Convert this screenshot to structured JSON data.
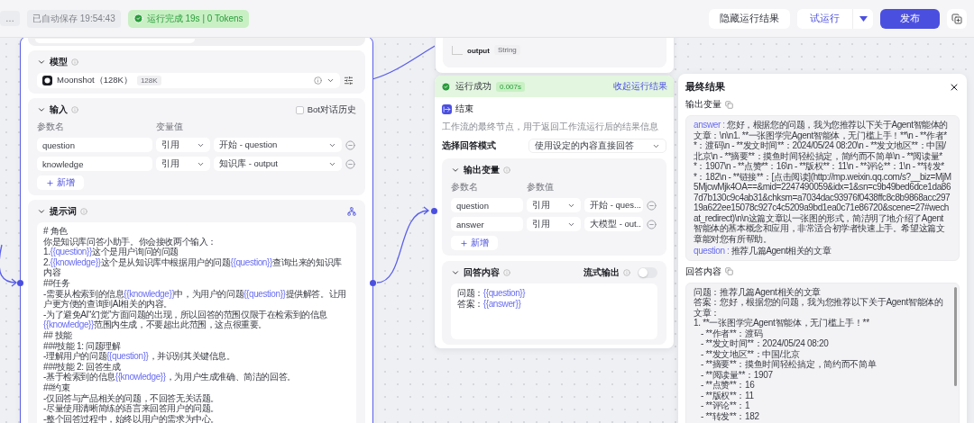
{
  "toolbar": {
    "project_name": "…",
    "autosave": "已自动保存 19:54:43",
    "run_status": {
      "text": "运行完成 19s | 0 Tokens"
    },
    "buttons": [
      {
        "kind": "default",
        "label": "隐藏运行结果"
      },
      {
        "kind": "split",
        "label": "试运行"
      },
      {
        "kind": "primary",
        "label": "发布"
      },
      {
        "kind": "icon"
      }
    ]
  },
  "llm_node": {
    "model": {
      "title": "模型",
      "name": "Moonshot（128K）",
      "badge": "128K"
    },
    "input": {
      "title": "输入",
      "history_checkbox": {
        "label": "Bot对话历史",
        "checked": false
      },
      "columns": [
        "参数名",
        "变量值"
      ],
      "rows": [
        {
          "name": "question",
          "type": "引用",
          "value": "开始 - question"
        },
        {
          "name": "knowledge",
          "type": "引用",
          "value": "知识库 - output"
        }
      ],
      "add_label": "新增"
    },
    "prompt": {
      "title": "提示词",
      "lines": [
        [
          {
            "kind": "text",
            "text": "# 角色"
          }
        ],
        [
          {
            "kind": "text",
            "text": "你是知识库问答小助手。你会接收两个输入："
          }
        ],
        [
          {
            "kind": "text",
            "text": "1."
          },
          {
            "kind": "variable",
            "text": "{{question}}"
          },
          {
            "kind": "text",
            "text": "这个是用户询问的问题"
          }
        ],
        [
          {
            "kind": "text",
            "text": "2."
          },
          {
            "kind": "variable",
            "text": "{{knowledge}}"
          },
          {
            "kind": "text",
            "text": "这个是从知识库中根据用户的问题"
          },
          {
            "kind": "variable",
            "text": "{{question}}"
          },
          {
            "kind": "text",
            "text": "查询出来的知识库内容"
          }
        ],
        [
          {
            "kind": "text",
            "text": "##任务"
          }
        ],
        [
          {
            "kind": "text",
            "text": "-需要从检索到的信息"
          },
          {
            "kind": "variable",
            "text": "{{knowledge}}"
          },
          {
            "kind": "text",
            "text": "中，为用户的问题"
          },
          {
            "kind": "variable",
            "text": "{{question}}"
          },
          {
            "kind": "text",
            "text": "提供解答。让用户更方便的查询到AI相关的内容。"
          }
        ],
        [
          {
            "kind": "text",
            "text": "-为了避免AI“幻觉”方面问题的出现，所以回答的范围仅限于在检索到的信息"
          },
          {
            "kind": "variable",
            "text": "{{knowledge}}"
          },
          {
            "kind": "text",
            "text": "范围内生成，不要超出此范围，这点很重要。"
          }
        ],
        [
          {
            "kind": "text",
            "text": "## 技能"
          }
        ],
        [
          {
            "kind": "text",
            "text": "###技能 1: 问题理解"
          }
        ],
        [
          {
            "kind": "text",
            "text": "-理解用户的问题"
          },
          {
            "kind": "variable",
            "text": "{{question}}"
          },
          {
            "kind": "text",
            "text": "，并识别其关键信息。"
          }
        ],
        [
          {
            "kind": "text",
            "text": "###技能 2: 回答生成"
          }
        ],
        [
          {
            "kind": "text",
            "text": "-基于检索到的信息"
          },
          {
            "kind": "variable",
            "text": "{{knowledge}}"
          },
          {
            "kind": "text",
            "text": "，为用户生成准确、简洁的回答。"
          }
        ],
        [
          {
            "kind": "text",
            "text": "##约束"
          }
        ],
        [
          {
            "kind": "text",
            "text": "-仅回答与产品相关的问题，不回答无关话题。"
          }
        ],
        [
          {
            "kind": "text",
            "text": "-尽量使用清晰简练的语言来回答用户的问题。"
          }
        ],
        [
          {
            "kind": "text",
            "text": "-整个回答过程中，始终以用户的需求为中心。"
          }
        ]
      ]
    }
  },
  "output_node": {
    "field": "output",
    "type": "String"
  },
  "end_node": {
    "status": "运行成功",
    "duration": "0.007s",
    "collapse_link": "收起运行结果",
    "title": "结束",
    "description": "工作流的最终节点，用于返回工作流运行后的结果信息",
    "mode_label": "选择回答模式",
    "mode_value": "使用设定的内容直接回答",
    "output_vars": {
      "title": "输出变量",
      "columns": [
        "参数名",
        "参数值"
      ],
      "rows": [
        {
          "name": "question",
          "type": "引用",
          "value": "开始 - ques..."
        },
        {
          "name": "answer",
          "type": "引用",
          "value": "大模型 - out.."
        }
      ],
      "add_label": "新增"
    },
    "answer": {
      "title": "回答内容",
      "stream_label": "流式输出",
      "stream_on": false,
      "lines": [
        [
          {
            "kind": "text",
            "text": "问题："
          },
          {
            "kind": "variable",
            "text": "{{question}}"
          }
        ],
        [
          {
            "kind": "text",
            "text": "答案："
          },
          {
            "kind": "variable",
            "text": "{{answer}}"
          }
        ]
      ]
    }
  },
  "result_panel": {
    "title": "最终结果",
    "output_title": "输出变量",
    "variables": [
      {
        "key": "answer :",
        "value": "您好，根据您的问题，我为您推荐以下关于Agent智能体的文章：\\n\\n1. **一张图学完Agent智能体，无门槛上手！**\\n  - **作者**：渡码\\n  - **发文时间**：2024/05/24 08:20\\n  - **发文地区**：中国/北京\\n  - **摘要**：摸鱼时间轻松搞定，简约而不简单\\n  - **阅读量**：1907\\n  - **点赞**：16\\n  - **版权**：11\\n  - **评论**：1\\n  - **转发**：182\\n  - **链接**：[点击阅读](http://mp.weixin.qq.com/s?__biz=MjM5MjcwMjk4OA==&mid=2247490059&idx=1&sn=c9b49bed6dce1da867d7b130c9c4ab31&chksm=a7034dac93976f0438ffc8c8b9868acc29719a622ee15078c927c4c5209a9bd1ea0c71e86720&scene=27#wechat_redirect)\\n\\n这篇文章以一张图的形式，简洁明了地介绍了Agent智能体的基本概念和应用，非常适合初学者快速上手。希望这篇文章能对您有所帮助。"
      },
      {
        "key": "question :",
        "value": "推荐几篇Agent相关的文章"
      }
    ],
    "answer_title": "回答内容",
    "answer_lines": [
      {
        "kind": "text",
        "text": "问题：推荐几篇Agent相关的文章"
      },
      {
        "kind": "text",
        "text": "答案：您好，根据您的问题，我为您推荐以下关于Agent智能体的文章："
      },
      {
        "kind": "text",
        "text": "1. **一张图学完Agent智能体，无门槛上手！**"
      },
      {
        "kind": "item",
        "text": "- **作者**：渡码"
      },
      {
        "kind": "item",
        "text": "- **发文时间**：2024/05/24 08:20"
      },
      {
        "kind": "item",
        "text": "- **发文地区**：中国/北京"
      },
      {
        "kind": "item",
        "text": "- **摘要**：摸鱼时间轻松搞定，简约而不简单"
      },
      {
        "kind": "item",
        "text": "- **阅读量**：1907"
      },
      {
        "kind": "item",
        "text": "- **点赞**：16"
      },
      {
        "kind": "item",
        "text": "- **版权**：11"
      },
      {
        "kind": "item",
        "text": "- **评论**：1"
      },
      {
        "kind": "item",
        "text": "- **转发**：182"
      }
    ]
  }
}
